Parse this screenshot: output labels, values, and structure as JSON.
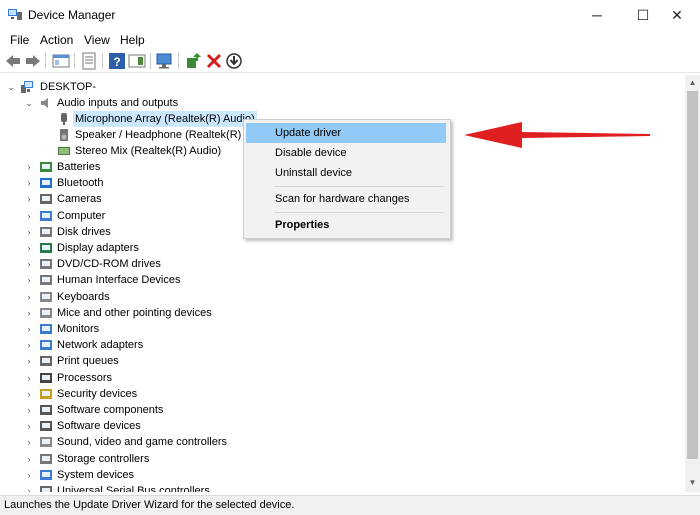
{
  "window": {
    "title": "Device Manager",
    "minimize": "─",
    "maximize": "☐",
    "close": "✕"
  },
  "menu": [
    "File",
    "Action",
    "View",
    "Help"
  ],
  "tree": {
    "root": "DESKTOP-",
    "audio_group": "Audio inputs and outputs",
    "audio_children": [
      "Microphone Array (Realtek(R) Audio)",
      "Speaker / Headphone (Realtek(R) Au",
      "Stereo Mix (Realtek(R) Audio)"
    ],
    "categories": [
      {
        "label": "Batteries",
        "icon": "battery-icon"
      },
      {
        "label": "Bluetooth",
        "icon": "bluetooth-icon"
      },
      {
        "label": "Cameras",
        "icon": "camera-icon"
      },
      {
        "label": "Computer",
        "icon": "computer-icon"
      },
      {
        "label": "Disk drives",
        "icon": "disk-drive-icon"
      },
      {
        "label": "Display adapters",
        "icon": "display-adapter-icon"
      },
      {
        "label": "DVD/CD-ROM drives",
        "icon": "dvd-drive-icon"
      },
      {
        "label": "Human Interface Devices",
        "icon": "hid-icon"
      },
      {
        "label": "Keyboards",
        "icon": "keyboard-icon"
      },
      {
        "label": "Mice and other pointing devices",
        "icon": "mouse-icon"
      },
      {
        "label": "Monitors",
        "icon": "monitor-icon"
      },
      {
        "label": "Network adapters",
        "icon": "network-adapter-icon"
      },
      {
        "label": "Print queues",
        "icon": "printer-icon"
      },
      {
        "label": "Processors",
        "icon": "processor-icon"
      },
      {
        "label": "Security devices",
        "icon": "security-device-icon"
      },
      {
        "label": "Software components",
        "icon": "software-component-icon"
      },
      {
        "label": "Software devices",
        "icon": "software-device-icon"
      },
      {
        "label": "Sound, video and game controllers",
        "icon": "sound-controller-icon"
      },
      {
        "label": "Storage controllers",
        "icon": "storage-controller-icon"
      },
      {
        "label": "System devices",
        "icon": "system-device-icon"
      },
      {
        "label": "Universal Serial Bus controllers",
        "icon": "usb-controller-icon"
      }
    ]
  },
  "context_menu": {
    "items": [
      "Update driver",
      "Disable device",
      "Uninstall device",
      "Scan for hardware changes",
      "Properties"
    ]
  },
  "status": {
    "text": "Launches the Update Driver Wizard for the selected device."
  },
  "colors": {
    "highlight": "#91c9f7",
    "arrow": "#e02020",
    "selection": "#cce8ff"
  }
}
